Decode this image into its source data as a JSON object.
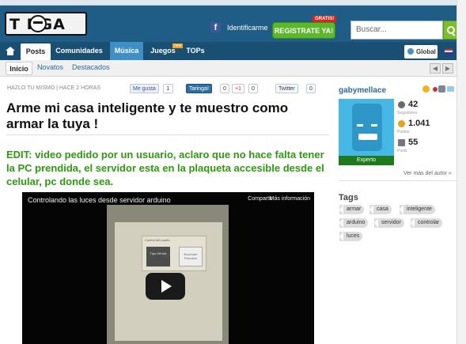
{
  "topstrip": {
    "link": "…"
  },
  "header": {
    "logo_text": "T NGA",
    "facebook_label": "Identificarme",
    "register_label": "REGISTRATE YA!",
    "register_badge": "GRATIS!",
    "search_placeholder": "Buscar..."
  },
  "nav": {
    "items": [
      {
        "label": "Posts"
      },
      {
        "label": "Comunidades"
      },
      {
        "label": "Música"
      },
      {
        "label": "Juegos"
      },
      {
        "label": "TOPs"
      }
    ],
    "juegos_badge": "new",
    "global_label": "Global"
  },
  "subnav": {
    "items": [
      {
        "label": "Inicio"
      },
      {
        "label": "Novatos"
      },
      {
        "label": "Destacados"
      }
    ],
    "prev": "◀",
    "next": "▶"
  },
  "post": {
    "meta": "HAZLO TU MISMO | HACE 2 HORAS",
    "share": {
      "fb_label": "Me gusta",
      "fb_count": "1",
      "taringa_label": "Taringa!",
      "taringa_count": "0",
      "gplus_label": "+1",
      "gplus_count": "0",
      "twitter_label": "Twitter",
      "twitter_count": "0"
    },
    "title": "Arme mi casa inteligente y te muestro como armar la tuya !",
    "edit": "EDIT: video pedido por un usuario, aclaro que no hace falta tener la PC prendida, el servidor esta en la plaqueta accesible desde el celular, pc donde sea.",
    "video": {
      "title": "Controlando las luces desde servidor arduino",
      "share_label": "Compartir",
      "more_label": "Más información",
      "screen_label": "Control del cuarto",
      "screen_btn1": "Tipo Off Ark",
      "screen_btn2": "Encender Prendido"
    }
  },
  "sidebar": {
    "user_name": "gabymellace",
    "avatar_label": "Experto",
    "stats": [
      {
        "value": "42",
        "sub": "Seguidores"
      },
      {
        "value": "1.041",
        "sub": "Puntos"
      },
      {
        "value": "55",
        "sub": "Posts"
      }
    ],
    "more_author": "Ver más del autor »",
    "tags_title": "Tags",
    "tags": [
      "armar",
      "casa",
      "inteligente",
      "arduino",
      "servidor",
      "controlar",
      "luces"
    ]
  },
  "colors": {
    "header_bg": "#1f5d86",
    "nav_active": "#3d8fc4",
    "edit_green": "#2d9a10",
    "register_green": "#5cb82a"
  }
}
